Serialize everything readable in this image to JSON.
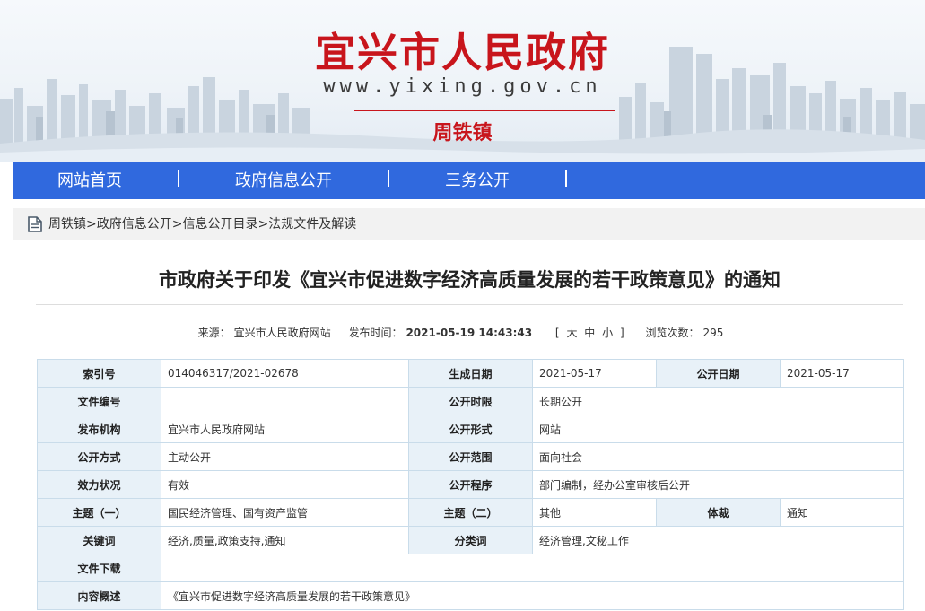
{
  "header": {
    "site_title": "宜兴市人民政府",
    "site_url": "www.yixing.gov.cn",
    "town_name": "周铁镇"
  },
  "nav": {
    "items": [
      {
        "label": "网站首页"
      },
      {
        "label": "政府信息公开"
      },
      {
        "label": "三务公开"
      }
    ]
  },
  "breadcrumb": {
    "items": [
      "周铁镇",
      "政府信息公开",
      "信息公开目录",
      "法规文件及解读"
    ],
    "separator": ">"
  },
  "article": {
    "title": "市政府关于印发《宜兴市促进数字经济高质量发展的若干政策意见》的通知",
    "meta": {
      "source_label": "来源：",
      "source_value": "宜兴市人民政府网站",
      "publish_label": "发布时间：",
      "publish_value": "2021-05-19 14:43:43",
      "font_open": "[",
      "font_large": "大",
      "font_medium": "中",
      "font_small": "小",
      "font_close": "]",
      "views_label": "浏览次数：",
      "views_value": "295"
    }
  },
  "info_table": {
    "index_label": "索引号",
    "index_value": "014046317/2021-02678",
    "gen_date_label": "生成日期",
    "gen_date_value": "2021-05-17",
    "pub_date_label": "公开日期",
    "pub_date_value": "2021-05-17",
    "doc_no_label": "文件编号",
    "doc_no_value": "",
    "period_label": "公开时限",
    "period_value": "长期公开",
    "org_label": "发布机构",
    "org_value": "宜兴市人民政府网站",
    "form_label": "公开形式",
    "form_value": "网站",
    "method_label": "公开方式",
    "method_value": "主动公开",
    "scope_label": "公开范围",
    "scope_value": "面向社会",
    "validity_label": "效力状况",
    "validity_value": "有效",
    "procedure_label": "公开程序",
    "procedure_value": "部门编制，经办公室审核后公开",
    "topic1_label": "主题（一）",
    "topic1_value": "国民经济管理、国有资产监管",
    "topic2_label": "主题（二）",
    "topic2_value": "其他",
    "genre_label": "体裁",
    "genre_value": "通知",
    "keywords_label": "关键词",
    "keywords_value": "经济,质量,政策支持,通知",
    "category_label": "分类词",
    "category_value": "经济管理,文秘工作",
    "download_label": "文件下载",
    "download_value": "",
    "summary_label": "内容概述",
    "summary_value": "《宜兴市促进数字经济高质量发展的若干政策意见》"
  },
  "colors": {
    "brand_red": "#c8151c",
    "nav_blue": "#3069de",
    "table_label_bg": "#e8f1f8",
    "table_border": "#c9dcea"
  },
  "icons": {
    "breadcrumb_icon": "document-icon"
  }
}
